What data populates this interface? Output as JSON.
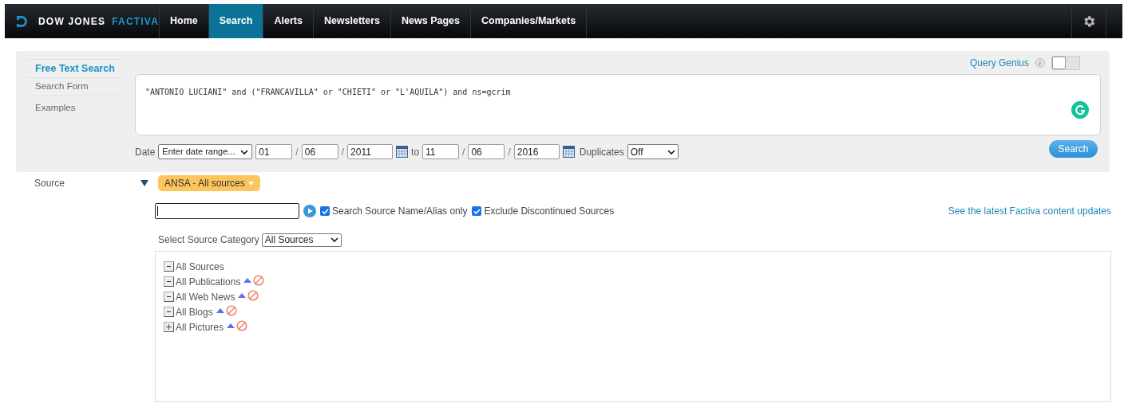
{
  "brand": {
    "name": "DOW JONES",
    "product": "FACTIVA"
  },
  "nav": [
    {
      "label": "Home",
      "selected": false
    },
    {
      "label": "Search",
      "selected": true
    },
    {
      "label": "Alerts",
      "selected": false
    },
    {
      "label": "Newsletters",
      "selected": false
    },
    {
      "label": "News Pages",
      "selected": false
    },
    {
      "label": "Companies/Markets",
      "selected": false
    }
  ],
  "search_modes": [
    {
      "label": "Free Text Search",
      "selected": true
    },
    {
      "label": "Search Form",
      "selected": false
    },
    {
      "label": "Examples",
      "selected": false
    }
  ],
  "query_genius": {
    "label": "Query Genius",
    "on": false
  },
  "query": "\"ANTONIO LUCIANI\" and (\"FRANCAVILLA\" or \"CHIETI\" or \"L'AQUILA\") and ns=gcrim",
  "date": {
    "label": "Date",
    "range": "Enter date range...",
    "from": [
      "01",
      "06",
      "2011"
    ],
    "to_label": "to",
    "to": [
      "11",
      "06",
      "2016"
    ],
    "separator": "/"
  },
  "duplicates": {
    "label": "Duplicates",
    "value": "Off"
  },
  "search_button": "Search",
  "source": {
    "label": "Source",
    "chip": "ANSA - All sources",
    "options": [
      {
        "label": "Search Source Name/Alias only",
        "checked": true
      },
      {
        "label": "Exclude Discontinued Sources",
        "checked": true
      }
    ],
    "updates_link": "See the latest Factiva content updates",
    "category_label": "Select Source Category",
    "category": "All Sources",
    "tree": [
      {
        "label": "All Sources",
        "kind": "root",
        "expanded": true
      },
      {
        "label": "All Publications",
        "kind": "category",
        "expanded": true
      },
      {
        "label": "All Web News",
        "kind": "category",
        "expanded": true
      },
      {
        "label": "All Blogs",
        "kind": "category",
        "expanded": true
      },
      {
        "label": "All Pictures",
        "kind": "category",
        "expanded": false
      }
    ]
  }
}
